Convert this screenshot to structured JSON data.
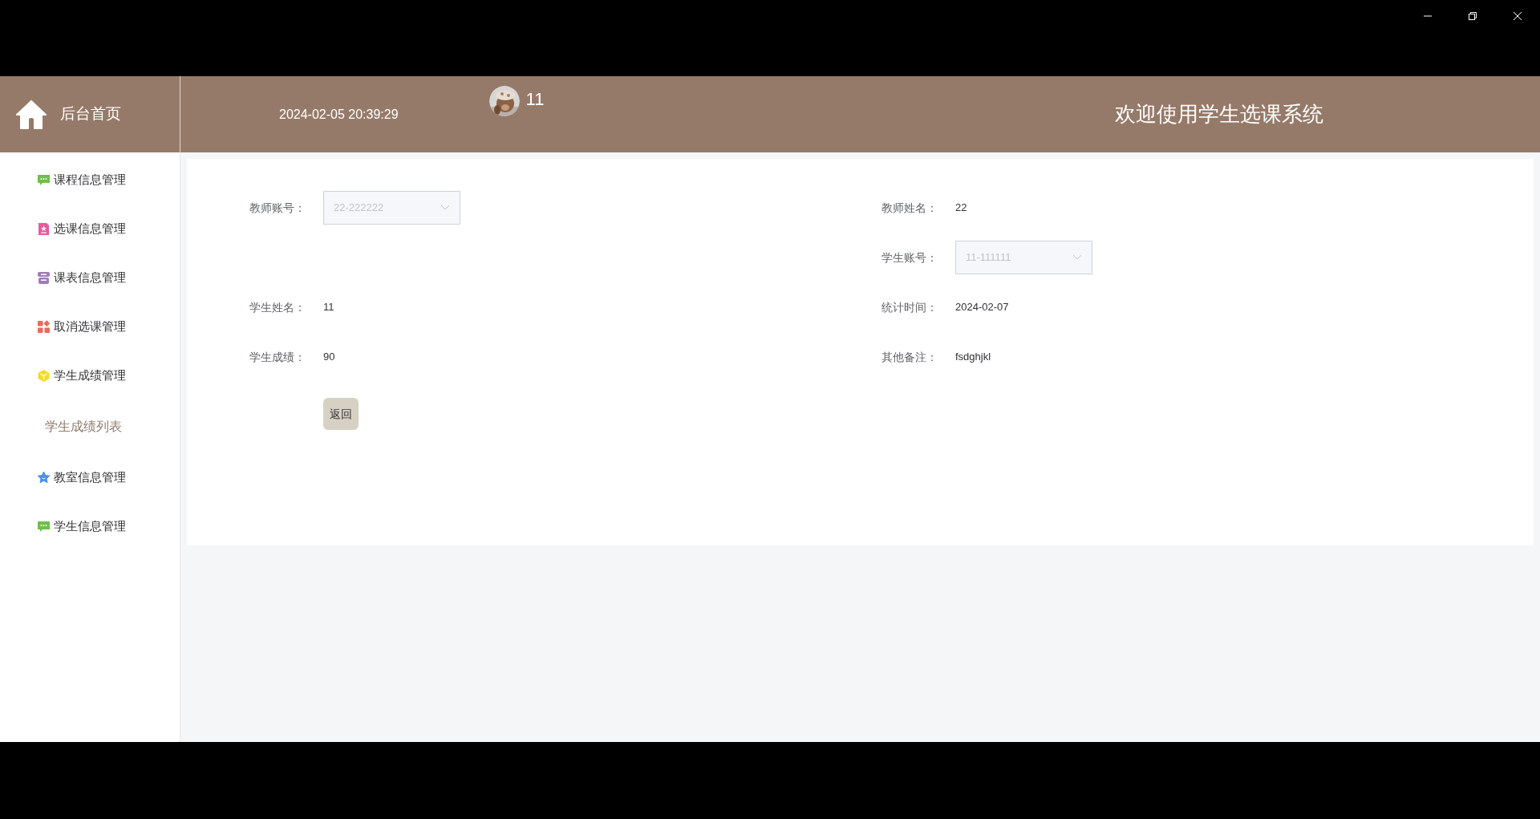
{
  "header": {
    "home_label": "后台首页",
    "datetime": "2024-02-05 20:39:29",
    "username": "11",
    "welcome": "欢迎使用学生选课系统"
  },
  "sidebar": {
    "items": [
      {
        "label": "课程信息管理",
        "kind": "chat"
      },
      {
        "label": "选课信息管理",
        "kind": "doc"
      },
      {
        "label": "课表信息管理",
        "kind": "archive"
      },
      {
        "label": "取消选课管理",
        "kind": "grid"
      },
      {
        "label": "学生成绩管理",
        "kind": "cube",
        "children": [
          {
            "label": "学生成绩列表",
            "selected": true
          }
        ]
      },
      {
        "label": "教室信息管理",
        "kind": "star"
      },
      {
        "label": "学生信息管理",
        "kind": "chat"
      }
    ]
  },
  "form": {
    "rows": [
      {
        "left": {
          "label": "教师账号：",
          "kind": "select",
          "value": "22-222222",
          "disabled": true
        },
        "right": {
          "label": "教师姓名：",
          "kind": "text",
          "value": "22"
        }
      },
      {
        "right": {
          "label": "学生账号：",
          "kind": "select",
          "value": "11-111111",
          "disabled": true
        }
      },
      {
        "left": {
          "label": "学生姓名：",
          "kind": "text",
          "value": "11"
        },
        "right": {
          "label": "统计时间：",
          "kind": "text",
          "value": "2024-02-07"
        }
      },
      {
        "left": {
          "label": "学生成绩：",
          "kind": "text",
          "value": "90"
        },
        "right": {
          "label": "其他备注：",
          "kind": "text",
          "value": "fsdghjkl"
        }
      }
    ],
    "back_button": "返回"
  }
}
